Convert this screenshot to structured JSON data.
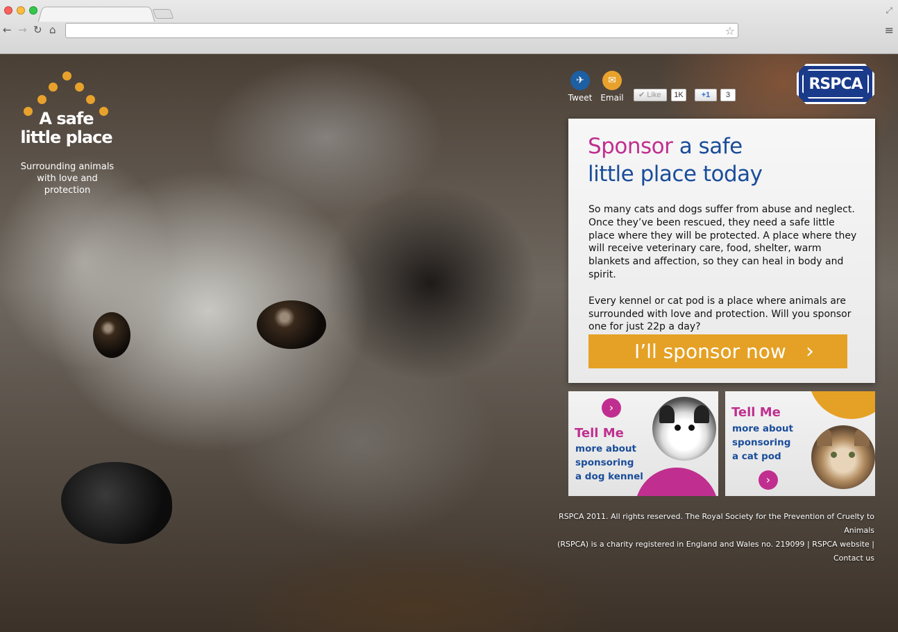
{
  "browser": {
    "url": "",
    "nav": {
      "back": "←",
      "forward": "→",
      "reload": "↻",
      "home": "⌂"
    },
    "star_icon": "☆",
    "menu_icon": "≡",
    "fullscreen_icon": "⤢"
  },
  "logo": {
    "title_line1": "A safe",
    "title_line2": "little place",
    "tagline_line1": "Surrounding animals",
    "tagline_line2": "with love and protection",
    "dot_color": "#e8a22c"
  },
  "social": {
    "tweet_label": "Tweet",
    "tweet_icon": "✈",
    "email_label": "Email",
    "email_icon": "✉",
    "like_label": "✔ Like",
    "like_count": "1K",
    "plusone_label": "+1",
    "plusone_count": "3"
  },
  "badge": {
    "text": "RSPCA",
    "color": "#1a3a8a"
  },
  "panel": {
    "heading_pink": "Sponsor",
    "heading_rest_1": " a safe",
    "heading_line2": "little place today",
    "para1": "So many cats and dogs suffer from abuse and neglect. Once they’ve been rescued, they need a safe little place where they will be protected. A place where they will receive veterinary care, food, shelter, warm blankets and affection, so they can heal in body and spirit.",
    "para2": "Every kennel or cat pod is a place where animals are surrounded with love and protection. Will you sponsor one for just 22p a day?",
    "cta_label": "I’ll sponsor now",
    "cta_icon": "›",
    "cta_color": "#e5a125"
  },
  "tiles": {
    "dog": {
      "head": "Tell Me",
      "line1": "more about",
      "line2": "sponsoring",
      "line3": "a dog kennel",
      "arrow_icon": "›"
    },
    "cat": {
      "head": "Tell Me",
      "line1": "more about",
      "line2": "sponsoring",
      "line3": "a cat pod",
      "arrow_icon": "›"
    },
    "accent_pink": "#c02f8f",
    "accent_blue": "#1a4d9a",
    "accent_orange": "#e5a125"
  },
  "footer": {
    "line1": "RSPCA 2011. All rights reserved. The Royal Society for the Prevention of Cruelty to Animals",
    "line2_prefix": "(RSPCA) is a charity registered in England and Wales no. 219099 | ",
    "link_website": "RSPCA website",
    "separator": " | ",
    "link_contact": "Contact us"
  }
}
